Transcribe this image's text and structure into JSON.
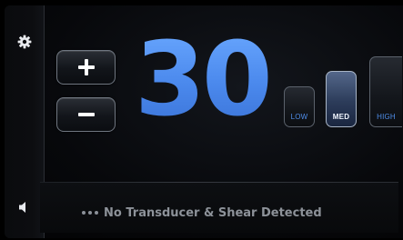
{
  "controls": {
    "increase_symbol": "+",
    "decrease_symbol": "−"
  },
  "display": {
    "value": "30"
  },
  "levels": {
    "items": [
      {
        "label": "LOW",
        "selected": false
      },
      {
        "label": "MED",
        "selected": true
      },
      {
        "label": "HIGH",
        "selected": false
      }
    ]
  },
  "status": {
    "message": "No Transducer & Shear Detected"
  },
  "icons": {
    "settings": "gear-icon",
    "sound": "speaker-icon"
  },
  "colors": {
    "accent": "#4e8ff0",
    "selected_level": "#2c3c5a",
    "status_text": "#8d9299"
  }
}
